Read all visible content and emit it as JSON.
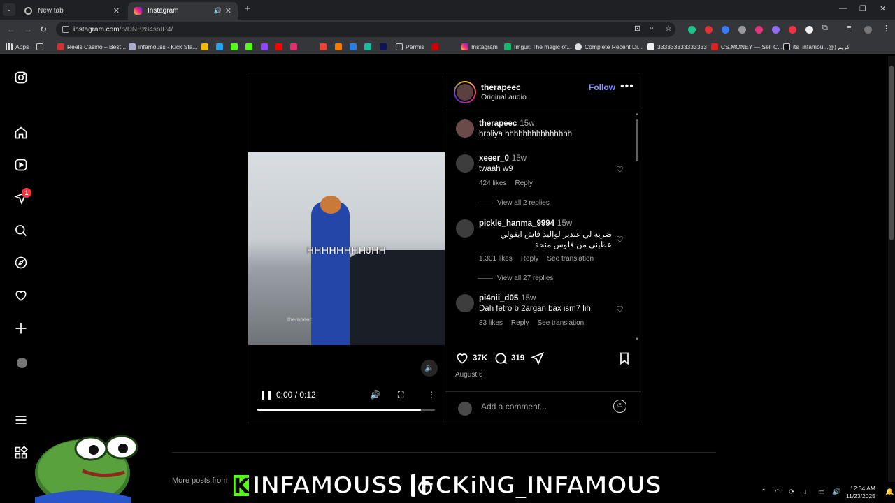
{
  "browser": {
    "tabs": [
      {
        "title": "New tab",
        "active": false
      },
      {
        "title": "Instagram",
        "active": true
      }
    ],
    "url": {
      "host": "instagram.com",
      "path": "/p/DNBz84soIP4/"
    },
    "bookmarks": [
      "Apps",
      "Reels Casino – Best...",
      "infamouss - Kick Sta...",
      "Permis",
      "Instagram",
      "Imgur: The magic of...",
      "Complete Recent Di...",
      "333333333333333",
      "CS.MONEY — Sell C...",
      "its_infamou...@) كريم"
    ]
  },
  "sidebar": {
    "icons": [
      "instagram-logo-icon",
      "home-icon",
      "reels-icon",
      "messages-icon",
      "search-icon",
      "explore-icon",
      "notifications-icon",
      "create-icon",
      "profile-icon",
      "menu-icon",
      "also-from-meta-icon"
    ],
    "messages_badge": "1"
  },
  "post": {
    "username": "therapeec",
    "audio": "Original audio",
    "follow_label": "Follow",
    "video": {
      "caption": "HHHHHHHHJHH",
      "watermark": "therapeec",
      "time": "0:00 / 0:12",
      "progress": 0.92
    },
    "comments": [
      {
        "user": "therapeec",
        "ago": "15w",
        "text": "hrbliya hhhhhhhhhhhhhhh",
        "likes": "",
        "reply": "",
        "translate": "",
        "view_replies": ""
      },
      {
        "user": "xeeer_0",
        "ago": "15w",
        "text": "twaah w9",
        "likes": "424 likes",
        "reply": "Reply",
        "translate": "",
        "view_replies": "View all 2 replies"
      },
      {
        "user": "pickle_hanma_9994",
        "ago": "15w",
        "text": "ضربة لي غندير لواليد فاش ايقولي عطيني من فلوس منحة",
        "likes": "1,301 likes",
        "reply": "Reply",
        "translate": "See translation",
        "view_replies": "View all 27 replies"
      },
      {
        "user": "pi4nii_d05",
        "ago": "15w",
        "text": "Dah fetro b 2argan bax ism7 lih",
        "likes": "83 likes",
        "reply": "Reply",
        "translate": "See translation",
        "view_replies": ""
      }
    ],
    "like_count": "37K",
    "comment_count": "319",
    "date": "August 6",
    "add_comment_placeholder": "Add a comment..."
  },
  "more_posts_label": "More posts from",
  "stream_overlay": {
    "kick_name": "INFAMOUSS",
    "instagram_name": "FCKiNG_INFAMOUS"
  },
  "taskbar": {
    "time": "12:34 AM",
    "date": "11/23/2025"
  },
  "colors": {
    "follow": "#8b96ff",
    "badge": "#ff3040",
    "kick_green": "#53fc18"
  }
}
